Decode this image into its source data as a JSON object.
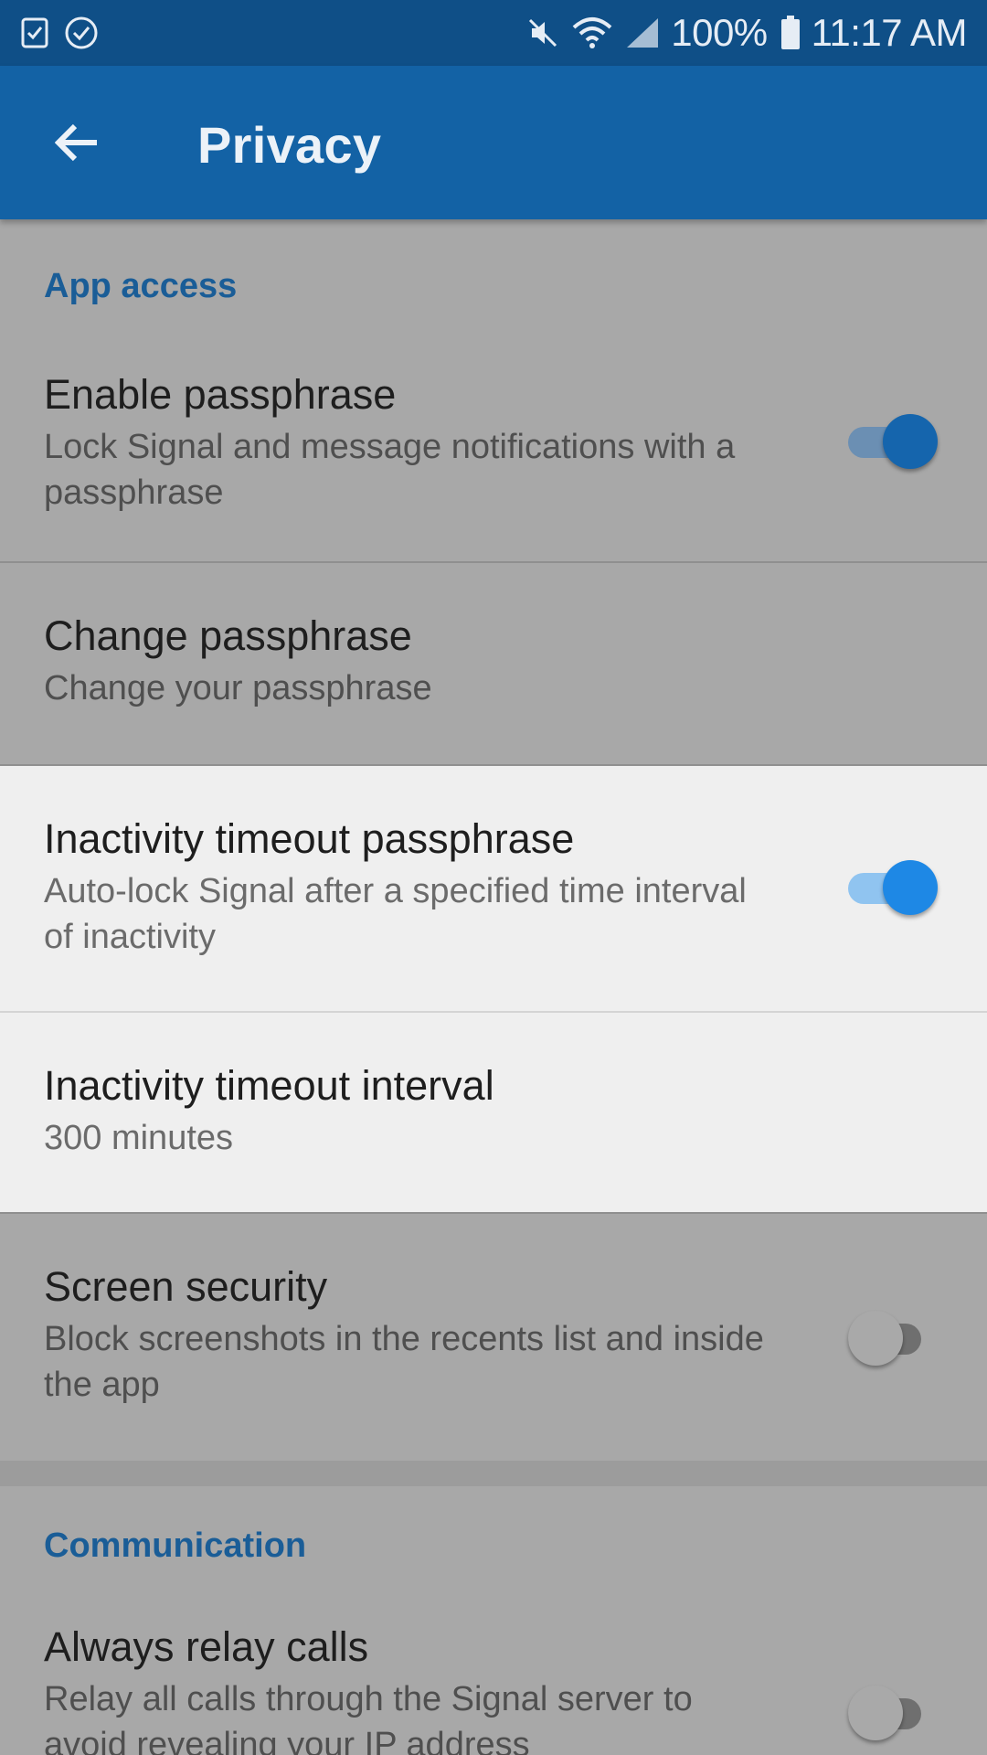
{
  "status_bar": {
    "left_icons": [
      "checklist-icon",
      "check-circle-icon"
    ],
    "right_icons": [
      "mute-icon",
      "wifi-icon",
      "signal-icon",
      "battery-icon"
    ],
    "battery": "100%",
    "time": "11:17 AM"
  },
  "app_bar": {
    "back_icon": "arrow-back-icon",
    "title": "Privacy"
  },
  "sections": {
    "app_access": {
      "header": "App access",
      "enable_passphrase": {
        "title": "Enable passphrase",
        "summary": "Lock Signal and message notifications with a passphrase",
        "enabled": true
      },
      "change_passphrase": {
        "title": "Change passphrase",
        "summary": "Change your passphrase"
      },
      "inactivity_timeout_passphrase": {
        "title": "Inactivity timeout passphrase",
        "summary": "Auto-lock Signal after a specified time interval of inactivity",
        "enabled": true
      },
      "inactivity_timeout_interval": {
        "title": "Inactivity timeout interval",
        "summary": "300 minutes"
      },
      "screen_security": {
        "title": "Screen security",
        "summary": "Block screenshots in the recents list and inside the app",
        "enabled": false
      }
    },
    "communication": {
      "header": "Communication",
      "always_relay_calls": {
        "title": "Always relay calls",
        "summary": "Relay all calls through the Signal server to avoid revealing your IP address",
        "enabled": false
      }
    }
  },
  "colors": {
    "status_bar": "#0f4f87",
    "app_bar": "#1362a5",
    "accent": "#1a5d97",
    "toggle_on_thumb_dim": "#1565ad",
    "toggle_on_thumb_active": "#1e88e5",
    "dimmed_background": "#a8a8a8",
    "highlight_background": "#efefef"
  }
}
